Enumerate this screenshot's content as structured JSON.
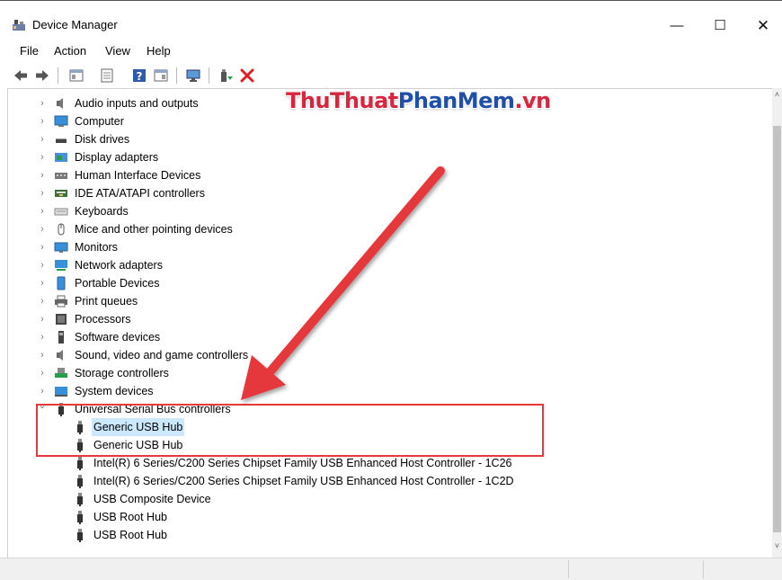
{
  "window": {
    "title": "Device Manager",
    "minimize_glyph": "—",
    "maximize_glyph": "☐",
    "close_glyph": "✕"
  },
  "menu": [
    "File",
    "Action",
    "View",
    "Help"
  ],
  "toolbar": {
    "icons": [
      "back-arrow-icon",
      "forward-arrow-icon",
      "properties-icon",
      "show-hidden-icon",
      "help-icon",
      "details-icon",
      "monitor-icon",
      "update-driver-icon",
      "uninstall-icon"
    ],
    "uninstall_color": "#e02020"
  },
  "tree": {
    "categories": [
      {
        "label": "Audio inputs and outputs",
        "icon": "speaker-icon"
      },
      {
        "label": "Computer",
        "icon": "computer-icon"
      },
      {
        "label": "Disk drives",
        "icon": "disk-drive-icon"
      },
      {
        "label": "Display adapters",
        "icon": "display-adapter-icon"
      },
      {
        "label": "Human Interface Devices",
        "icon": "hid-icon"
      },
      {
        "label": "IDE ATA/ATAPI controllers",
        "icon": "ide-controller-icon"
      },
      {
        "label": "Keyboards",
        "icon": "keyboard-icon"
      },
      {
        "label": "Mice and other pointing devices",
        "icon": "mouse-icon"
      },
      {
        "label": "Monitors",
        "icon": "monitor-icon"
      },
      {
        "label": "Network adapters",
        "icon": "network-adapter-icon"
      },
      {
        "label": "Portable Devices",
        "icon": "portable-device-icon"
      },
      {
        "label": "Print queues",
        "icon": "printer-icon"
      },
      {
        "label": "Processors",
        "icon": "processor-icon"
      },
      {
        "label": "Software devices",
        "icon": "software-device-icon"
      },
      {
        "label": "Sound, video and game controllers",
        "icon": "speaker-icon"
      },
      {
        "label": "Storage controllers",
        "icon": "storage-controller-icon"
      },
      {
        "label": "System devices",
        "icon": "system-device-icon"
      }
    ],
    "expanded_category": {
      "label": "Universal Serial Bus controllers",
      "icon": "usb-icon"
    },
    "usb_children": [
      {
        "label": "Generic USB Hub",
        "selected": true
      },
      {
        "label": "Generic USB Hub",
        "selected": false
      },
      {
        "label": "Intel(R) 6 Series/C200 Series Chipset Family USB Enhanced Host Controller - 1C26",
        "selected": false
      },
      {
        "label": "Intel(R) 6 Series/C200 Series Chipset Family USB Enhanced Host Controller - 1C2D",
        "selected": false
      },
      {
        "label": "USB Composite Device",
        "selected": false
      },
      {
        "label": "USB Root Hub",
        "selected": false
      },
      {
        "label": "USB Root Hub",
        "selected": false
      }
    ],
    "collapsed_glyph": "›",
    "expanded_glyph": "⌄",
    "selection_color": "#cce8ff"
  },
  "scrollbar": {
    "up_glyph": "˄",
    "down_glyph": "˅"
  },
  "watermark": {
    "part1": "ThuThuat",
    "part2": "PhanMem",
    "part3": ".vn"
  },
  "annotation": {
    "color": "#e5393d"
  }
}
